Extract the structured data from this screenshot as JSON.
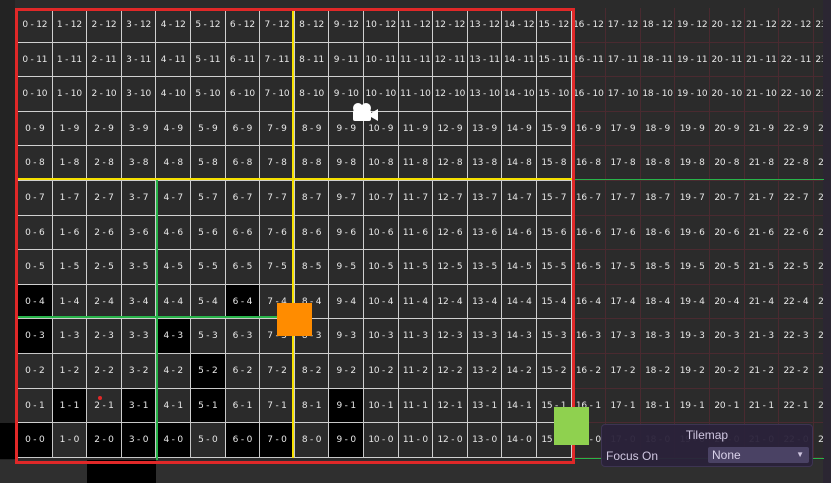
{
  "tilemap": {
    "cols": 24,
    "rows": 13,
    "dark_tiles": [
      "0-4",
      "0-3",
      "4-3",
      "5-2",
      "6-4",
      "0-0",
      "2-0",
      "4-0",
      "6-0",
      "9-0",
      "9-1",
      "7-0",
      "3-0",
      "1-1",
      "5-1",
      "3-1"
    ],
    "colors": {
      "cell_line": "#ffffff",
      "dark_tile": "#000000",
      "yellow_line": "#f5e000",
      "green_line": "#28b44a",
      "red_border": "#e02828",
      "orange_marker": "#ff8c00",
      "green_marker": "#8fd14f"
    }
  },
  "icons": {
    "camera": "camera-icon"
  },
  "overlay": {
    "title": "Tilemap",
    "focus_label": "Focus On",
    "focus_value": "None",
    "dropdown_icon": "chevron-down-icon"
  }
}
